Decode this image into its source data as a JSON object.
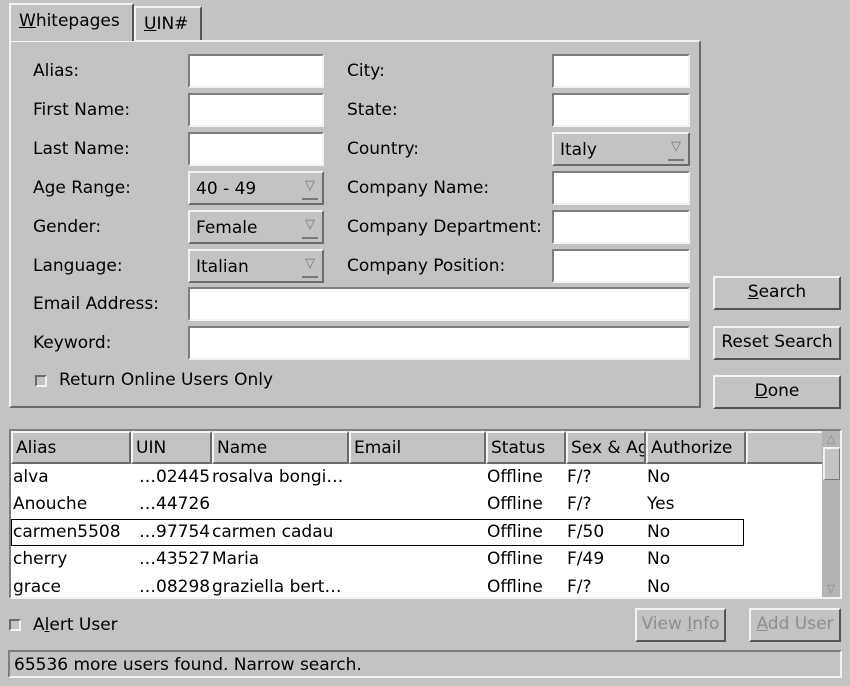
{
  "tabs": [
    {
      "label_mnemonic": "W",
      "label_rest": "hitepages"
    },
    {
      "label_mnemonic": "U",
      "label_rest": "IN#"
    }
  ],
  "form": {
    "alias_label": "Alias:",
    "first_name_label": "First Name:",
    "last_name_label": "Last Name:",
    "age_range_label": "Age Range:",
    "age_range_value": "40 - 49",
    "gender_label": "Gender:",
    "gender_value": "Female",
    "language_label": "Language:",
    "language_value": "Italian",
    "email_label": "Email Address:",
    "keyword_label": "Keyword:",
    "city_label": "City:",
    "state_label": "State:",
    "country_label": "Country:",
    "country_value": "Italy",
    "company_name_label": "Company Name:",
    "company_department_label": "Company Department:",
    "company_position_label": "Company Position:",
    "online_only_label": "Return Online Users Only",
    "alias_value": "",
    "first_name_value": "",
    "last_name_value": "",
    "city_value": "",
    "state_value": "",
    "company_name_value": "",
    "company_department_value": "",
    "company_position_value": "",
    "email_value": "",
    "keyword_value": ""
  },
  "buttons": {
    "search_mn": "S",
    "search_rest": "earch",
    "reset": "Reset Search",
    "done_mn": "D",
    "done_rest": "one",
    "view_info_pre": "View ",
    "view_info_mn": "I",
    "view_info_rest": "nfo",
    "add_user_mn": "A",
    "add_user_rest": "dd User"
  },
  "results": {
    "columns": [
      "Alias",
      "UIN",
      "Name",
      "Email",
      "Status",
      "Sex & Age",
      "Authorize"
    ],
    "rows": [
      {
        "alias": "alva",
        "uin": "…02445",
        "name": "rosalva bongi…",
        "email": "",
        "status": "Offline",
        "sex_age": "F/?",
        "authorize": "No"
      },
      {
        "alias": "Anouche",
        "uin": "…44726",
        "name": "",
        "email": "",
        "status": "Offline",
        "sex_age": "F/?",
        "authorize": "Yes"
      },
      {
        "alias": "carmen5508",
        "uin": "…97754",
        "name": "carmen cadau",
        "email": "",
        "status": "Offline",
        "sex_age": "F/50",
        "authorize": "No"
      },
      {
        "alias": "cherry",
        "uin": "…43527",
        "name": "Maria",
        "email": "",
        "status": "Offline",
        "sex_age": "F/49",
        "authorize": "No"
      },
      {
        "alias": "grace",
        "uin": "…08298",
        "name": "graziella bert…",
        "email": "",
        "status": "Offline",
        "sex_age": "F/?",
        "authorize": "No"
      }
    ]
  },
  "alert_user": {
    "pre": "A",
    "mn": "l",
    "rest": "ert User"
  },
  "status_text": "65536 more users found. Narrow search.",
  "icons": {
    "dropdown": "triangle-down-icon",
    "scroll_up": "arrow-up-icon",
    "scroll_down": "arrow-down-icon"
  }
}
